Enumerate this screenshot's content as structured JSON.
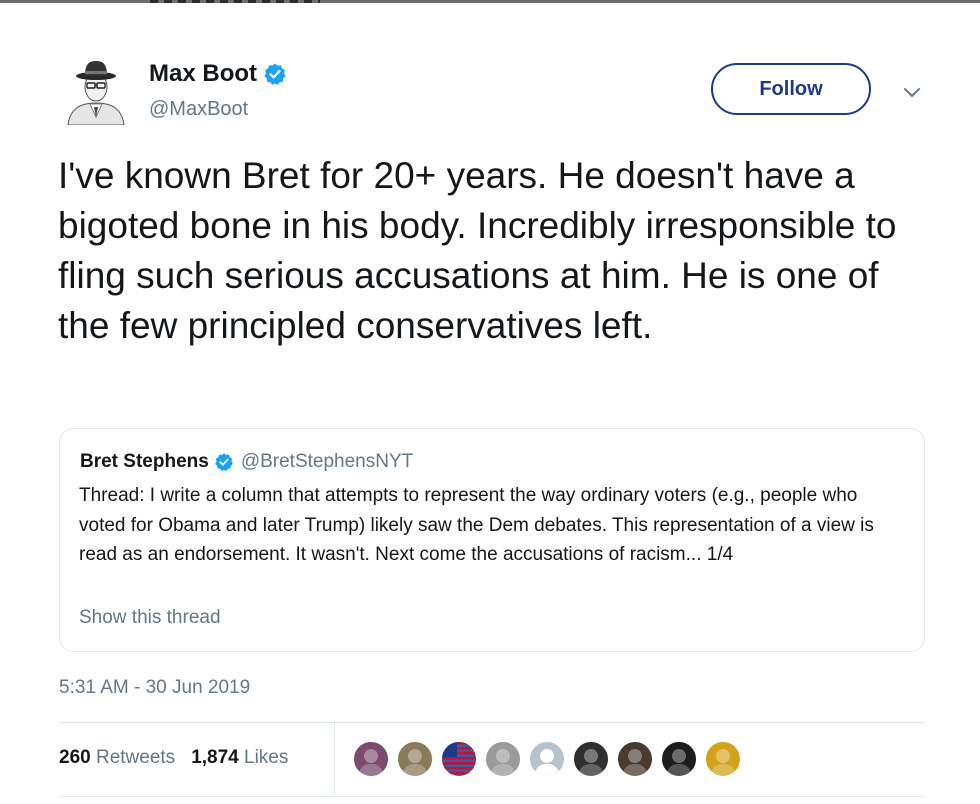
{
  "author": {
    "name": "Max Boot",
    "handle": "@MaxBoot",
    "verified": true,
    "avatar_icon": "avatar-fedora-man"
  },
  "actions": {
    "follow_label": "Follow",
    "more_icon": "chevron-down-icon"
  },
  "tweet": {
    "text": "I've known Bret for 20+ years. He doesn't have a bigoted bone in his body. Incredibly irresponsible to fling such serious accusations at him. He is one of the few principled conservatives left.",
    "timestamp": "5:31 AM - 30 Jun 2019"
  },
  "quoted_tweet": {
    "name": "Bret Stephens",
    "handle": "@BretStephensNYT",
    "verified": true,
    "text": "Thread: I write a column that attempts to represent the way ordinary voters (e.g., people who voted for Obama and later Trump) likely saw the Dem debates. This representation of a view is read as an endorsement. It wasn't. Next come the accusations of racism... 1/4",
    "show_thread_label": "Show this thread"
  },
  "stats": {
    "retweets_count": "260",
    "retweets_label": "Retweets",
    "likes_count": "1,874",
    "likes_label": "Likes"
  },
  "likers": [
    {
      "icon": "liker-avatar-1",
      "color": "#7a4b6d"
    },
    {
      "icon": "liker-avatar-2",
      "color": "#8a7a5c"
    },
    {
      "icon": "liker-avatar-flag",
      "color": "#3b5aa8"
    },
    {
      "icon": "liker-avatar-4",
      "color": "#9a9a9a"
    },
    {
      "icon": "liker-avatar-default",
      "color": "#b6c2cc"
    },
    {
      "icon": "liker-avatar-6",
      "color": "#2f2f2f"
    },
    {
      "icon": "liker-avatar-7",
      "color": "#4a3a2e"
    },
    {
      "icon": "liker-avatar-8",
      "color": "#1c1c1c"
    },
    {
      "icon": "liker-avatar-9",
      "color": "#d4a21a"
    }
  ],
  "colors": {
    "follow_border": "#1c3a8a",
    "verified_blue": "#1da1f2",
    "secondary_text": "#657786",
    "divider": "#e1e8ed"
  }
}
